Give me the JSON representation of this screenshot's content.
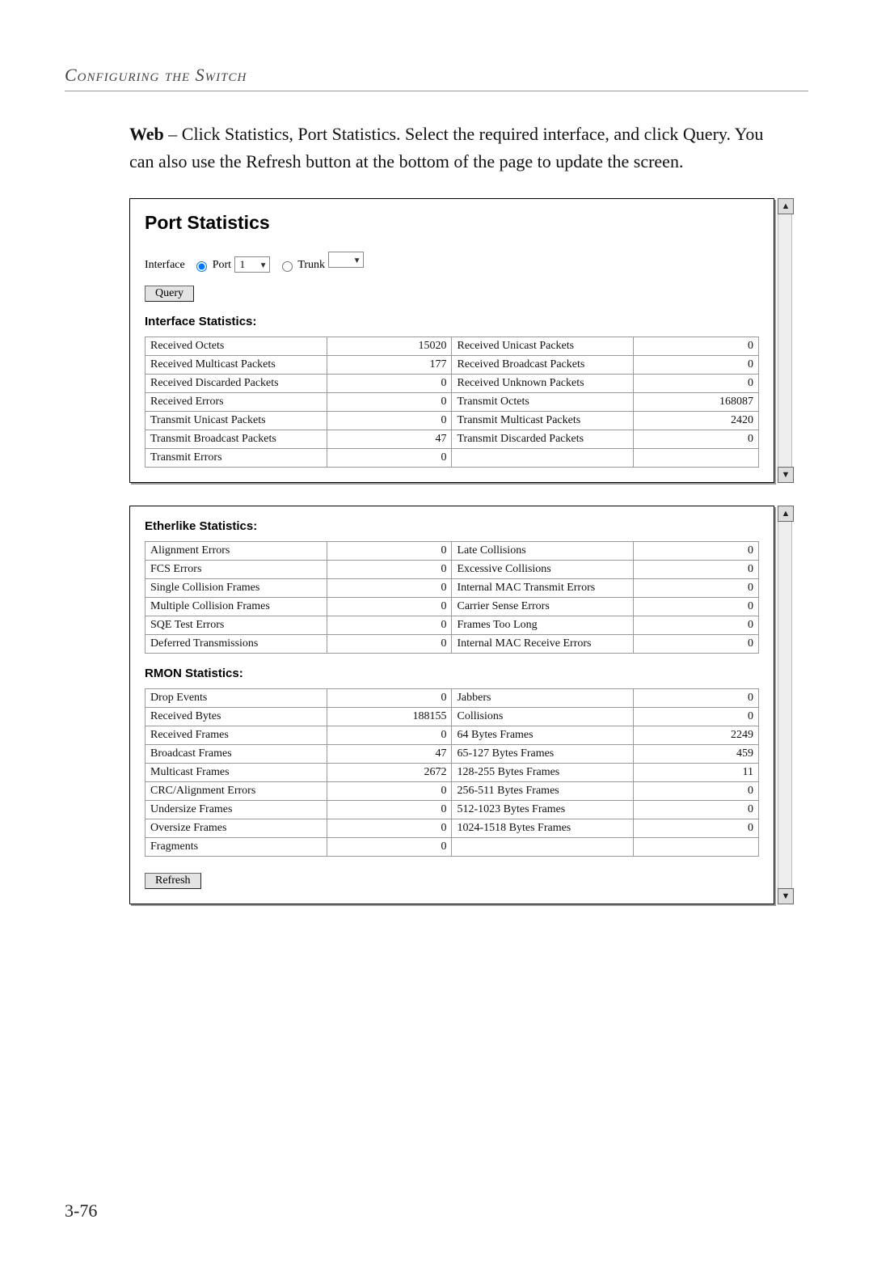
{
  "running_head": "Configuring the Switch",
  "body_web_label": "Web",
  "body_web_text": " – Click Statistics, Port Statistics. Select the required interface, and click Query. You can also use the Refresh button at the bottom of the page to update the screen.",
  "figure1": {
    "heading": "Port Statistics",
    "interface_label": "Interface",
    "port_label": "Port",
    "port_value": "1",
    "trunk_label": "Trunk",
    "trunk_value": "",
    "query_button": "Query",
    "section_title": "Interface Statistics:",
    "rows": [
      {
        "l1": "Received Octets",
        "v1": "15020",
        "l2": "Received Unicast Packets",
        "v2": "0"
      },
      {
        "l1": "Received Multicast Packets",
        "v1": "177",
        "l2": "Received Broadcast Packets",
        "v2": "0"
      },
      {
        "l1": "Received Discarded Packets",
        "v1": "0",
        "l2": "Received Unknown Packets",
        "v2": "0"
      },
      {
        "l1": "Received Errors",
        "v1": "0",
        "l2": "Transmit Octets",
        "v2": "168087"
      },
      {
        "l1": "Transmit Unicast Packets",
        "v1": "0",
        "l2": "Transmit Multicast Packets",
        "v2": "2420"
      },
      {
        "l1": "Transmit Broadcast Packets",
        "v1": "47",
        "l2": "Transmit Discarded Packets",
        "v2": "0"
      },
      {
        "l1": "Transmit Errors",
        "v1": "0",
        "l2": "",
        "v2": ""
      }
    ]
  },
  "figure2": {
    "section1_title": "Etherlike Statistics:",
    "rows1": [
      {
        "l1": "Alignment Errors",
        "v1": "0",
        "l2": "Late Collisions",
        "v2": "0"
      },
      {
        "l1": "FCS Errors",
        "v1": "0",
        "l2": "Excessive Collisions",
        "v2": "0"
      },
      {
        "l1": "Single Collision Frames",
        "v1": "0",
        "l2": "Internal MAC Transmit Errors",
        "v2": "0"
      },
      {
        "l1": "Multiple Collision Frames",
        "v1": "0",
        "l2": "Carrier Sense Errors",
        "v2": "0"
      },
      {
        "l1": "SQE Test Errors",
        "v1": "0",
        "l2": "Frames Too Long",
        "v2": "0"
      },
      {
        "l1": "Deferred Transmissions",
        "v1": "0",
        "l2": "Internal MAC Receive Errors",
        "v2": "0"
      }
    ],
    "section2_title": "RMON Statistics:",
    "rows2": [
      {
        "l1": "Drop Events",
        "v1": "0",
        "l2": "Jabbers",
        "v2": "0"
      },
      {
        "l1": "Received Bytes",
        "v1": "188155",
        "l2": "Collisions",
        "v2": "0"
      },
      {
        "l1": "Received Frames",
        "v1": "0",
        "l2": "64 Bytes Frames",
        "v2": "2249"
      },
      {
        "l1": "Broadcast Frames",
        "v1": "47",
        "l2": "65-127 Bytes Frames",
        "v2": "459"
      },
      {
        "l1": "Multicast Frames",
        "v1": "2672",
        "l2": "128-255 Bytes Frames",
        "v2": "11"
      },
      {
        "l1": "CRC/Alignment Errors",
        "v1": "0",
        "l2": "256-511 Bytes Frames",
        "v2": "0"
      },
      {
        "l1": "Undersize Frames",
        "v1": "0",
        "l2": "512-1023 Bytes Frames",
        "v2": "0"
      },
      {
        "l1": "Oversize Frames",
        "v1": "0",
        "l2": "1024-1518 Bytes Frames",
        "v2": "0"
      },
      {
        "l1": "Fragments",
        "v1": "0",
        "l2": "",
        "v2": ""
      }
    ],
    "refresh_button": "Refresh"
  },
  "page_number": "3-76"
}
